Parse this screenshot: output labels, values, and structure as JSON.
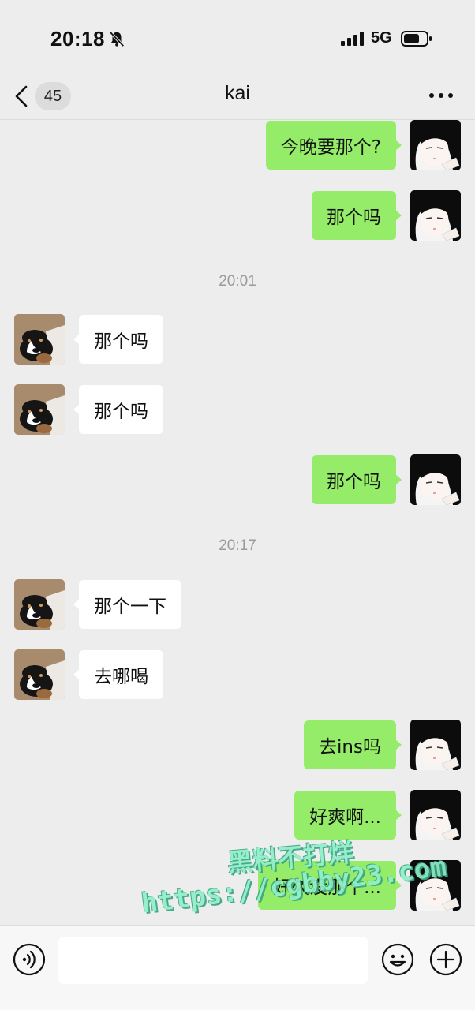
{
  "status_bar": {
    "time": "20:18",
    "network": "5G",
    "icons": [
      "bell-muted-icon",
      "signal-icon",
      "battery-icon"
    ]
  },
  "nav": {
    "back_icon": "chevron-left-icon",
    "unread_count": "45",
    "title": "kai",
    "more_icon": "more-dots-icon"
  },
  "messages": [
    {
      "direction": "out",
      "text": "今晚要那个?"
    },
    {
      "direction": "out",
      "text": "那个吗"
    },
    {
      "timestamp": "20:01"
    },
    {
      "direction": "in",
      "text": "那个吗"
    },
    {
      "direction": "in",
      "text": "那个吗"
    },
    {
      "direction": "out",
      "text": "那个吗"
    },
    {
      "timestamp": "20:17"
    },
    {
      "direction": "in",
      "text": "那个一下"
    },
    {
      "direction": "in",
      "text": "去哪喝"
    },
    {
      "direction": "out",
      "text": "去ins吗"
    },
    {
      "direction": "out",
      "text": "好爽啊..."
    },
    {
      "direction": "out",
      "text": "好久没那个..."
    }
  ],
  "watermark": {
    "line1": "黑料不打烊",
    "line2": "https://cgbby23.com"
  },
  "input_bar": {
    "voice_icon": "voice-icon",
    "input_value": "",
    "emoji_icon": "emoji-icon",
    "plus_icon": "plus-icon"
  },
  "colors": {
    "background": "#ededed",
    "outgoing_bubble": "#95ec69",
    "incoming_bubble": "#ffffff",
    "timestamp_text": "#9a9a9a",
    "watermark": "#8ff0c8"
  }
}
